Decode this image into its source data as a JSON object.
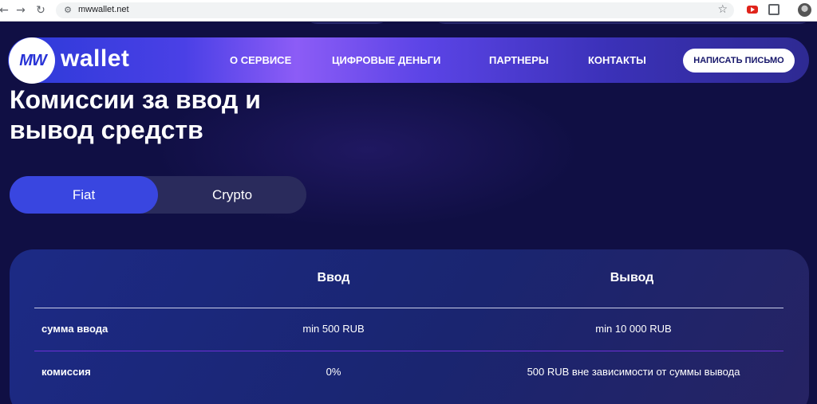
{
  "browser": {
    "url": "mwwallet.net",
    "icons": [
      "back-arrow-icon",
      "forward-arrow-icon",
      "reload-icon",
      "site-info-icon",
      "bookmark-star-icon",
      "youtube-extension-icon",
      "extensions-puzzle-icon",
      "profile-avatar-icon"
    ]
  },
  "navbar": {
    "logo_mark": "MW",
    "logo_word": "wallet",
    "links": [
      "О СЕРВИСЕ",
      "ЦИФРОВЫЕ ДЕНЬГИ",
      "ПАРТНЕРЫ",
      "КОНТАКТЫ"
    ],
    "cta_label": "НАПИСАТЬ ПИСЬМО"
  },
  "page": {
    "heading_line1": "Комиссии за ввод и",
    "heading_line2": "вывод средств"
  },
  "tabs": {
    "fiat": "Fiat",
    "crypto": "Crypto",
    "active": "Fiat"
  },
  "table": {
    "columns": [
      "",
      "Ввод",
      "Вывод"
    ],
    "rows": [
      {
        "label": "сумма ввода",
        "deposit": "min 500 RUB",
        "withdraw": "min 10 000 RUB"
      },
      {
        "label": "комиссия",
        "deposit": "0%",
        "withdraw": "500 RUB вне зависимости от суммы вывода"
      }
    ]
  },
  "colors": {
    "background": "#100f44",
    "accent": "#3946e0",
    "divider_highlight": "#6d2fd6"
  }
}
